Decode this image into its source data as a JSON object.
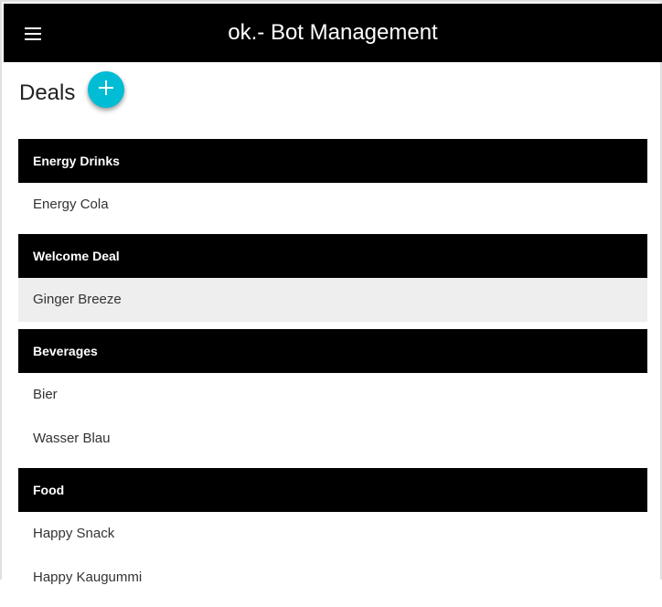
{
  "app": {
    "title": "ok.- Bot Management"
  },
  "page": {
    "title": "Deals"
  },
  "icons": {
    "menu": "menu-icon",
    "add": "plus-icon"
  },
  "colors": {
    "toolbar": "#000000",
    "fab": "#00bcd4",
    "selected_row": "#eeeeee"
  },
  "groups": [
    {
      "title": "Energy Drinks",
      "items": [
        {
          "label": "Energy Cola",
          "selected": false
        }
      ]
    },
    {
      "title": "Welcome Deal",
      "items": [
        {
          "label": "Ginger Breeze",
          "selected": true
        }
      ]
    },
    {
      "title": "Beverages",
      "items": [
        {
          "label": "Bier",
          "selected": false
        },
        {
          "label": "Wasser Blau",
          "selected": false
        }
      ]
    },
    {
      "title": "Food",
      "items": [
        {
          "label": "Happy Snack",
          "selected": false
        },
        {
          "label": "Happy Kaugummi",
          "selected": false
        }
      ]
    }
  ]
}
